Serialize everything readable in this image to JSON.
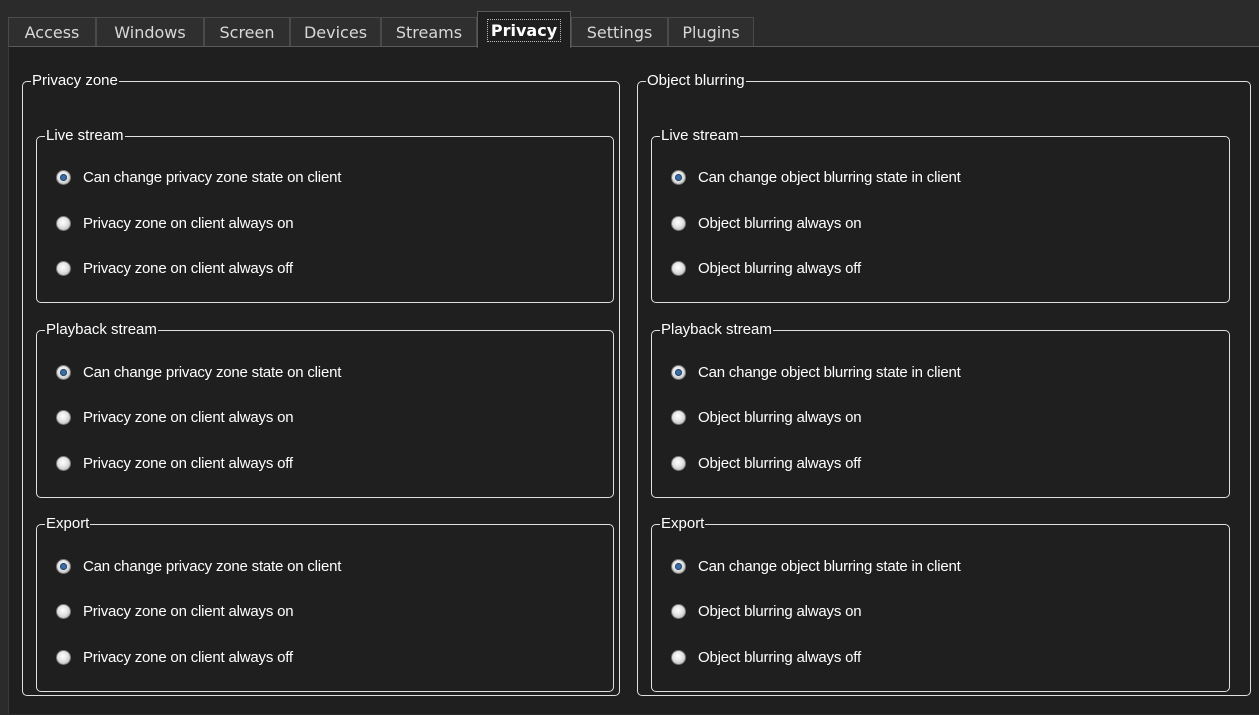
{
  "tabs": [
    "Access",
    "Windows",
    "Screen",
    "Devices",
    "Streams",
    "Privacy",
    "Settings",
    "Plugins"
  ],
  "active_tab": "Privacy",
  "privacy_zone": {
    "title": "Privacy zone",
    "groups": [
      {
        "title": "Live stream",
        "options": [
          "Can change privacy zone state on client",
          "Privacy zone on client always on",
          "Privacy zone on client always off"
        ],
        "selected": 0
      },
      {
        "title": "Playback stream",
        "options": [
          "Can change privacy zone state on client",
          "Privacy zone on client always on",
          "Privacy zone on client always off"
        ],
        "selected": 0
      },
      {
        "title": "Export",
        "options": [
          "Can change privacy zone state on client",
          "Privacy zone on client always on",
          "Privacy zone on client always off"
        ],
        "selected": 0
      }
    ]
  },
  "object_blurring": {
    "title": "Object blurring",
    "groups": [
      {
        "title": "Live stream",
        "options": [
          "Can change object blurring state in client",
          "Object blurring always on",
          "Object blurring always off"
        ],
        "selected": 0
      },
      {
        "title": "Playback stream",
        "options": [
          "Can change object blurring state in client",
          "Object blurring always on",
          "Object blurring always off"
        ],
        "selected": 0
      },
      {
        "title": "Export",
        "options": [
          "Can change object blurring state in client",
          "Object blurring always on",
          "Object blurring always off"
        ],
        "selected": 0
      }
    ]
  },
  "colors": {
    "background": "#1f1f1f",
    "radio_selected": "#3a6ea5",
    "border": "#e0e0e0"
  }
}
